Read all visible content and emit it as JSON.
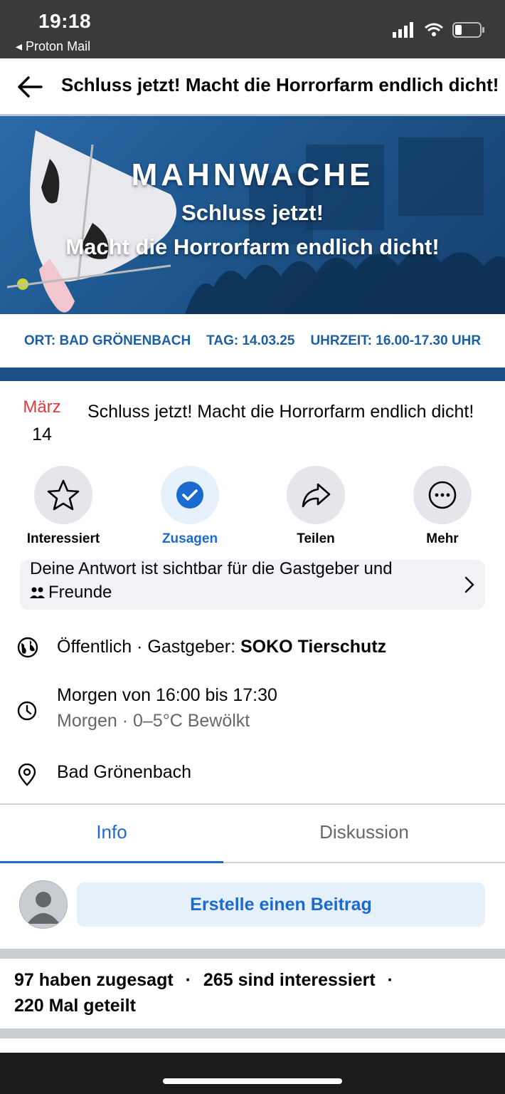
{
  "status_bar": {
    "time": "19:18",
    "back_app": "◂ Proton Mail"
  },
  "header": {
    "title": "Schluss jetzt! Macht die Horrorfarm endlich dicht!"
  },
  "banner": {
    "headline": "MAHNWACHE",
    "line1": "Schluss jetzt!",
    "line2": "Macht die Horrorfarm endlich dicht!",
    "ort": "ORT: BAD GRÖNENBACH",
    "tag": "TAG: 14.03.25",
    "uhrzeit": "UHRZEIT: 16.00-17.30 UHR"
  },
  "event": {
    "month": "März",
    "day": "14",
    "title": "Schluss jetzt! Macht die Horrorfarm endlich dicht!"
  },
  "actions": [
    {
      "label": "Interessiert",
      "icon": "star-icon"
    },
    {
      "label": "Zusagen",
      "icon": "check-circle-icon"
    },
    {
      "label": "Teilen",
      "icon": "share-icon"
    },
    {
      "label": "Mehr",
      "icon": "more-icon"
    }
  ],
  "notice": {
    "line1": "Deine Antwort ist sichtbar für die Gastgeber und",
    "line2": "Freunde"
  },
  "details": {
    "privacy": "Öffentlich · Gastgeber: ",
    "host": "SOKO Tierschutz",
    "time": "Morgen von 16:00 bis 17:30",
    "weather": "Morgen · 0–5°C Bewölkt",
    "location": "Bad Grönenbach"
  },
  "tabs": [
    {
      "label": "Info",
      "active": true
    },
    {
      "label": "Diskussion",
      "active": false
    }
  ],
  "post": {
    "button": "Erstelle einen Beitrag"
  },
  "stats": {
    "going": "97 haben zugesagt",
    "interested": "265 sind interessiert",
    "shared": "220 Mal geteilt"
  },
  "colors": {
    "accent": "#1b6ad0",
    "month_red": "#e0383e",
    "status_bar": "#3a3a3c"
  }
}
